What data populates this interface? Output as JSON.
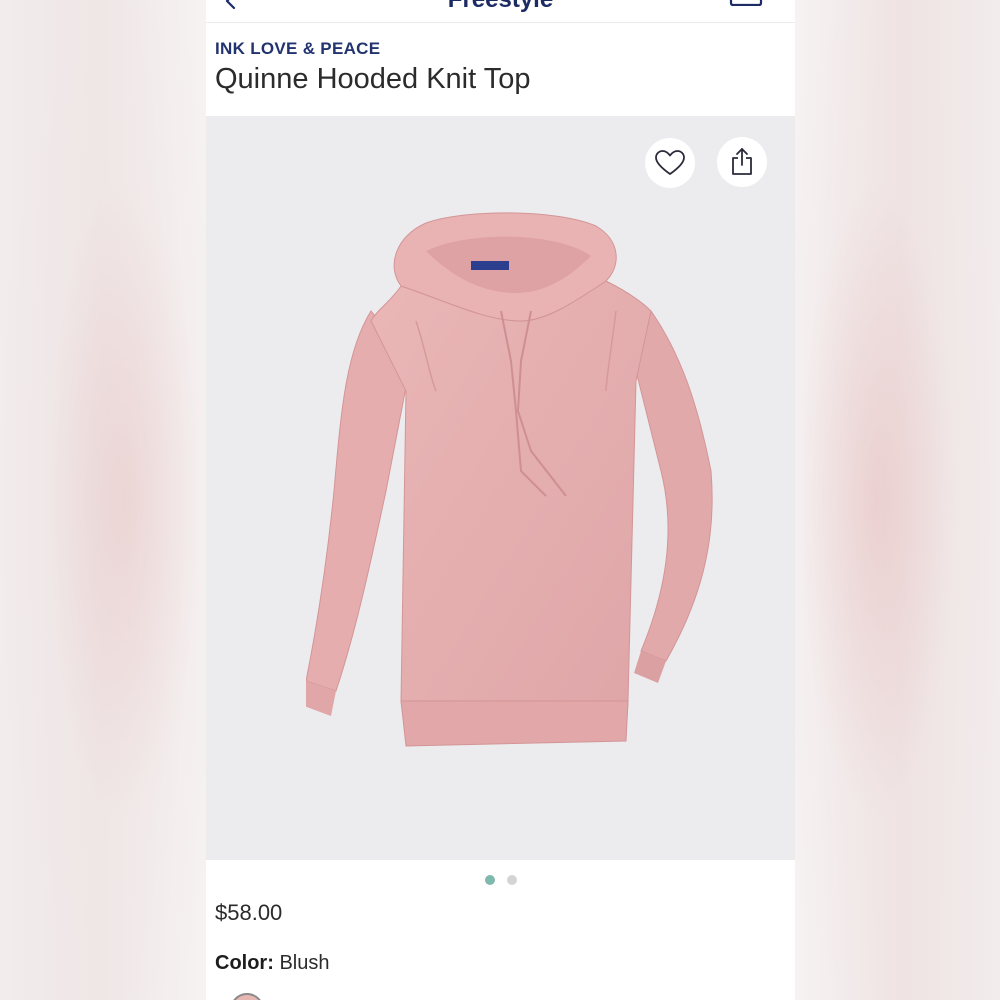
{
  "header": {
    "app_title": "Freestyle"
  },
  "product": {
    "brand": "INK LOVE & PEACE",
    "title": "Quinne Hooded Knit Top",
    "price": "$58.00",
    "color_label": "Color:",
    "color_value": "Blush"
  },
  "gallery": {
    "current_image": 1,
    "total_images": 2,
    "garment_color": "#e8b3b3"
  },
  "icons": {
    "back": "chevron-left-icon",
    "bag": "bag-icon",
    "favorite": "heart-icon",
    "share": "share-icon"
  },
  "colors": {
    "brand_navy": "#22336f",
    "dot_active": "#7fb8ad",
    "dot_inactive": "#d4d4d4"
  }
}
